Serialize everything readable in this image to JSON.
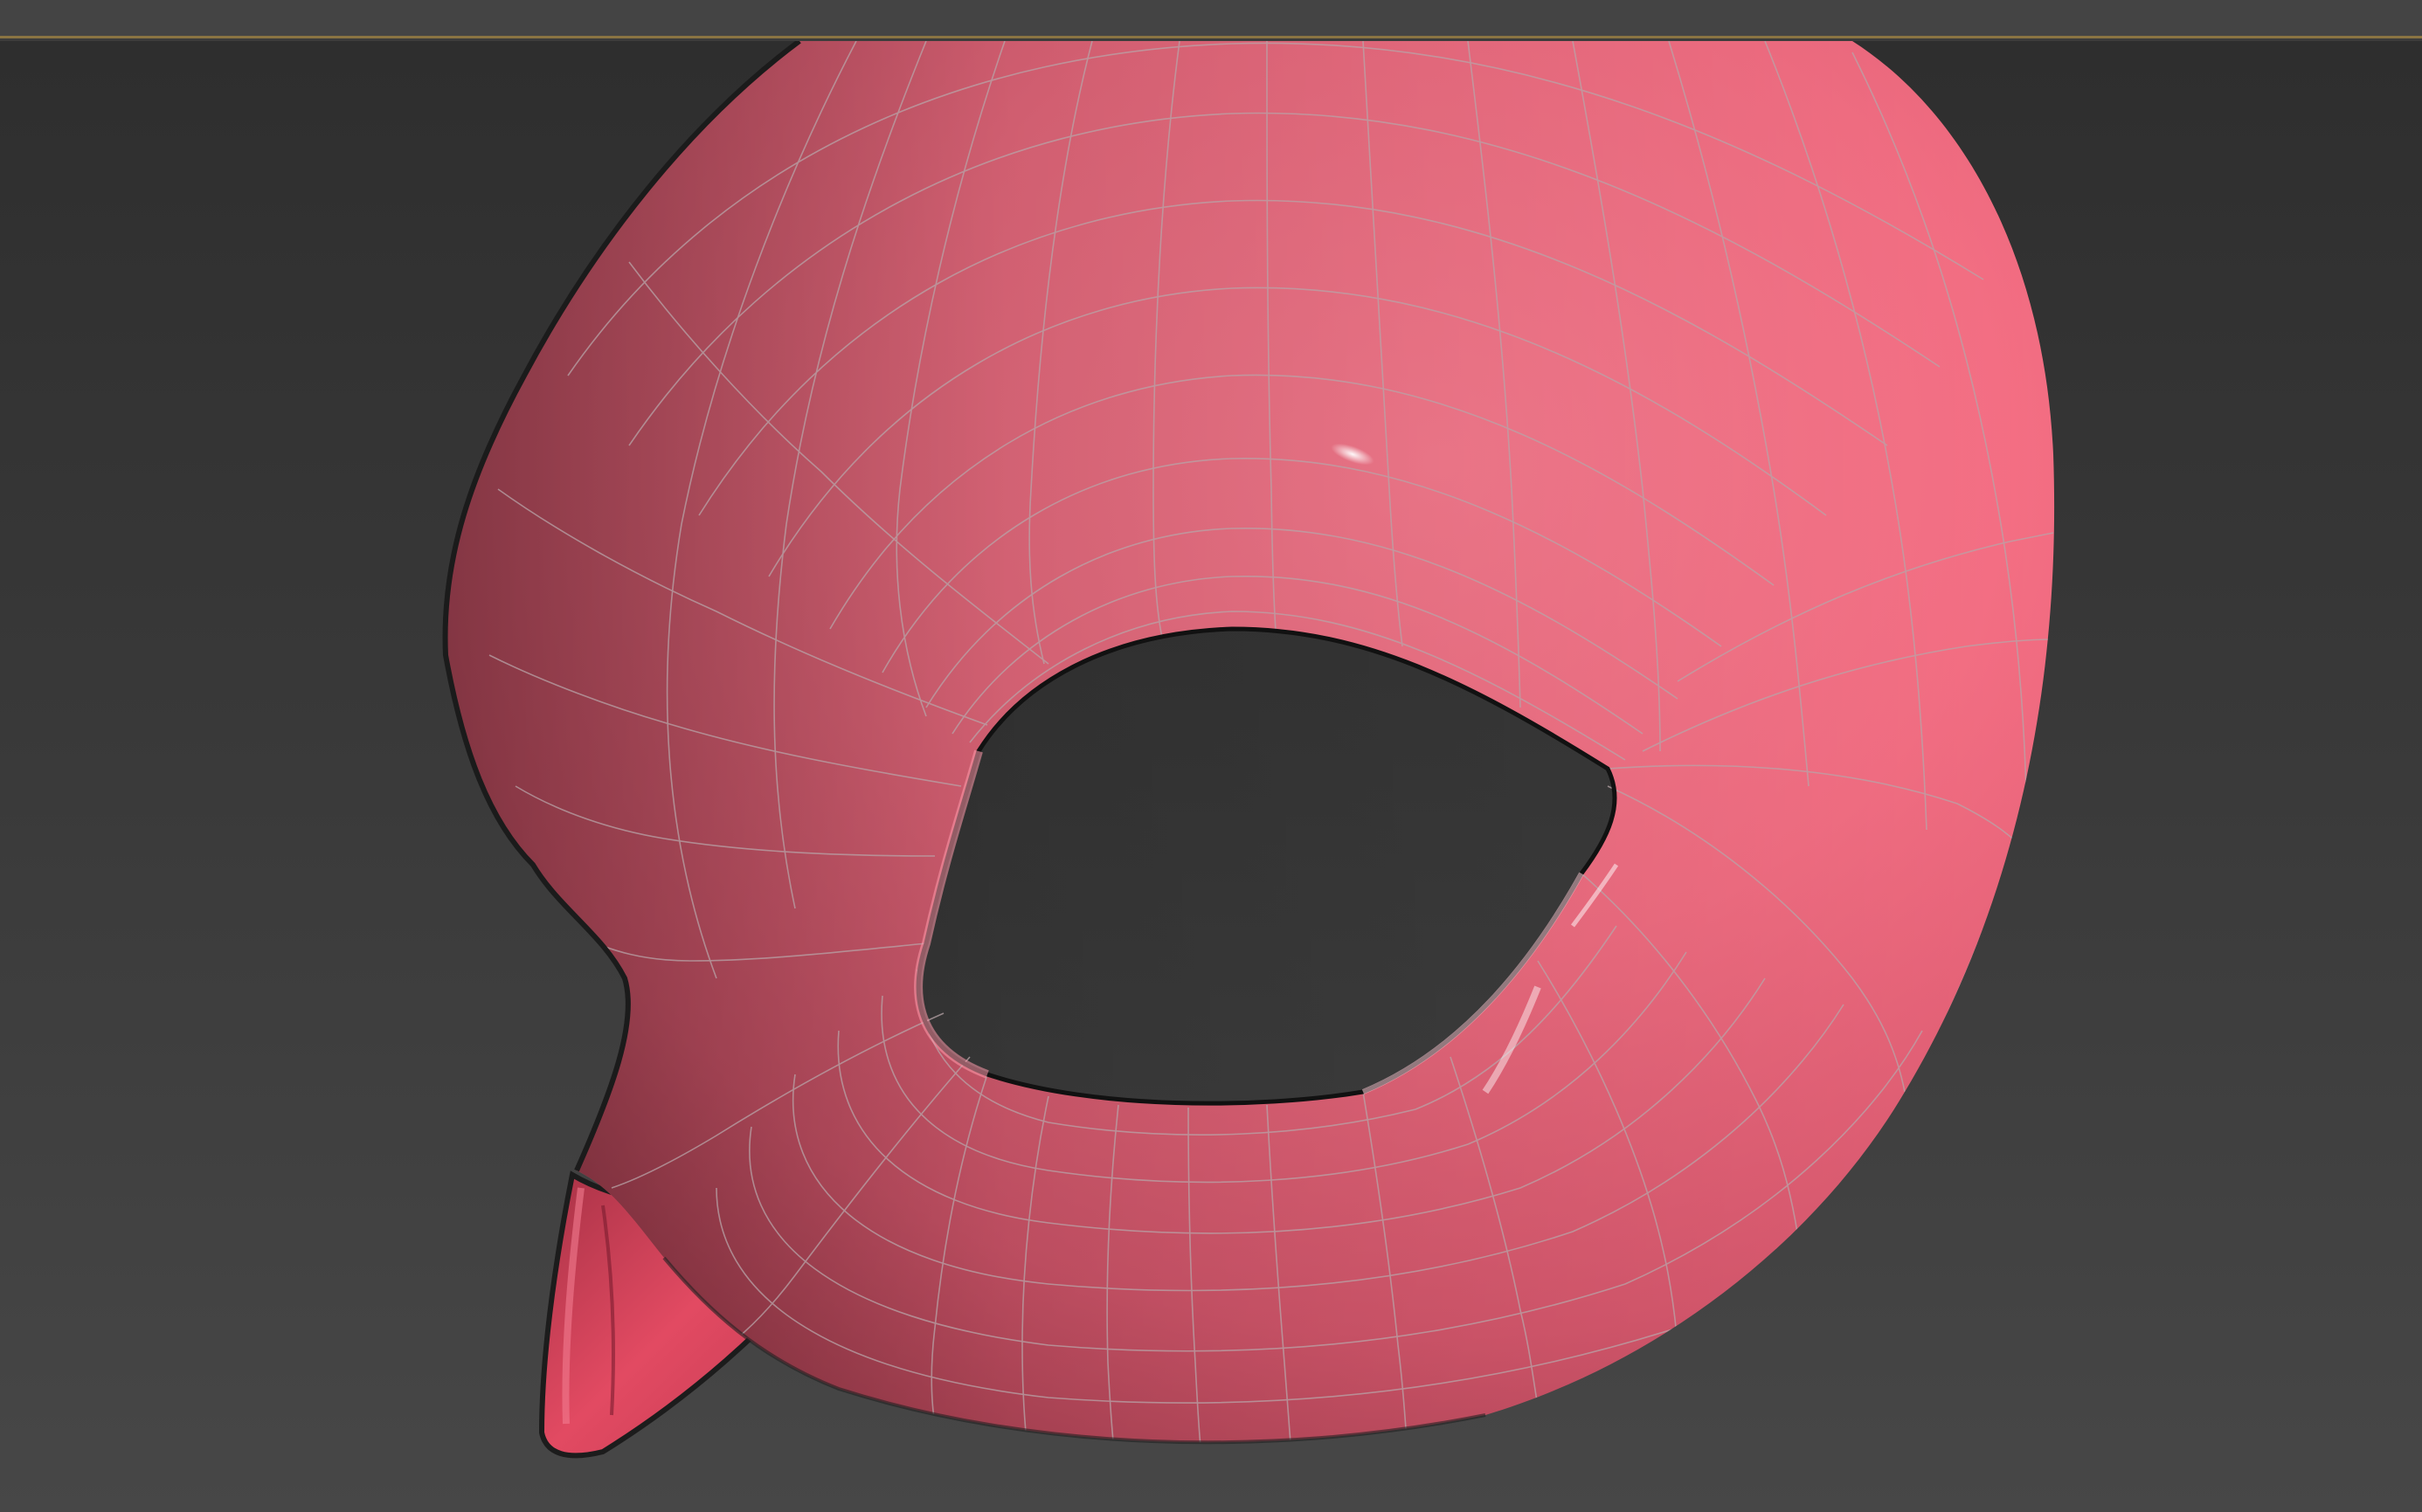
{
  "app": {
    "viewport": {
      "object": "mask-mesh",
      "material_color": "#f06a80",
      "wireframe_color": "#b8a4a8",
      "background_top": "#2e2e2e",
      "background_bottom": "#474747",
      "toolbar_accent": "#8a7442"
    }
  }
}
